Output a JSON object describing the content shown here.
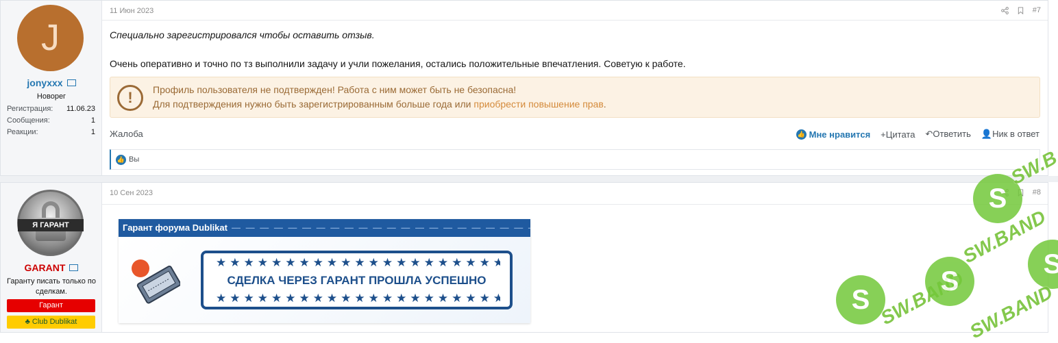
{
  "posts": [
    {
      "user": {
        "avatar_letter": "J",
        "name": "jonyxxx",
        "title": "Новорег",
        "stats": [
          {
            "label": "Регистрация:",
            "value": "11.06.23"
          },
          {
            "label": "Сообщения:",
            "value": "1"
          },
          {
            "label": "Реакции:",
            "value": "1"
          }
        ]
      },
      "date": "11 Июн 2023",
      "number": "#7",
      "body_line1": "Специально зарегистрировался чтобы оставить отзыв.",
      "body_line2": "Очень оперативно и точно по тз выполнили задачу и учли пожелания, остались положительные впечатления. Советую к работе.",
      "warning": {
        "line1": "Профиль пользователя не подтвержден! Работа с ним может быть не безопасна!",
        "line2": "Для подтверждения нужно быть зарегистрированным больше года или ",
        "link": "приобрести повышение прав",
        "suffix": "."
      },
      "report": "Жалоба",
      "actions": {
        "like": "Мне нравится",
        "quote": "+Цитата",
        "reply": "Ответить",
        "mention": "Ник в ответ"
      },
      "likes_by": "Вы"
    },
    {
      "user": {
        "avatar_text": "Я ГАРАНТ",
        "name": "GARANT",
        "title": "Гаранту писать только по сделкам.",
        "badges": [
          "Гарант",
          "Club Dublikat"
        ]
      },
      "date": "10 Сен 2023",
      "number": "#8",
      "banner": {
        "header": "Гарант форума Dublikat",
        "seal_text": "СДЕЛКА ЧЕРЕЗ ГАРАНТ ПРОШЛА УСПЕШНО"
      }
    }
  ],
  "watermark": "SW.BAND",
  "colors": {
    "accent": "#2577b1",
    "warning_bg": "#fcf2e4",
    "warning_text": "#9a6a35",
    "garant_name": "#cc0000",
    "badge_red": "#e60000",
    "badge_yellow": "#ffcc00",
    "banner_blue": "#1f5aa0",
    "watermark_green": "#6fbf2f"
  }
}
